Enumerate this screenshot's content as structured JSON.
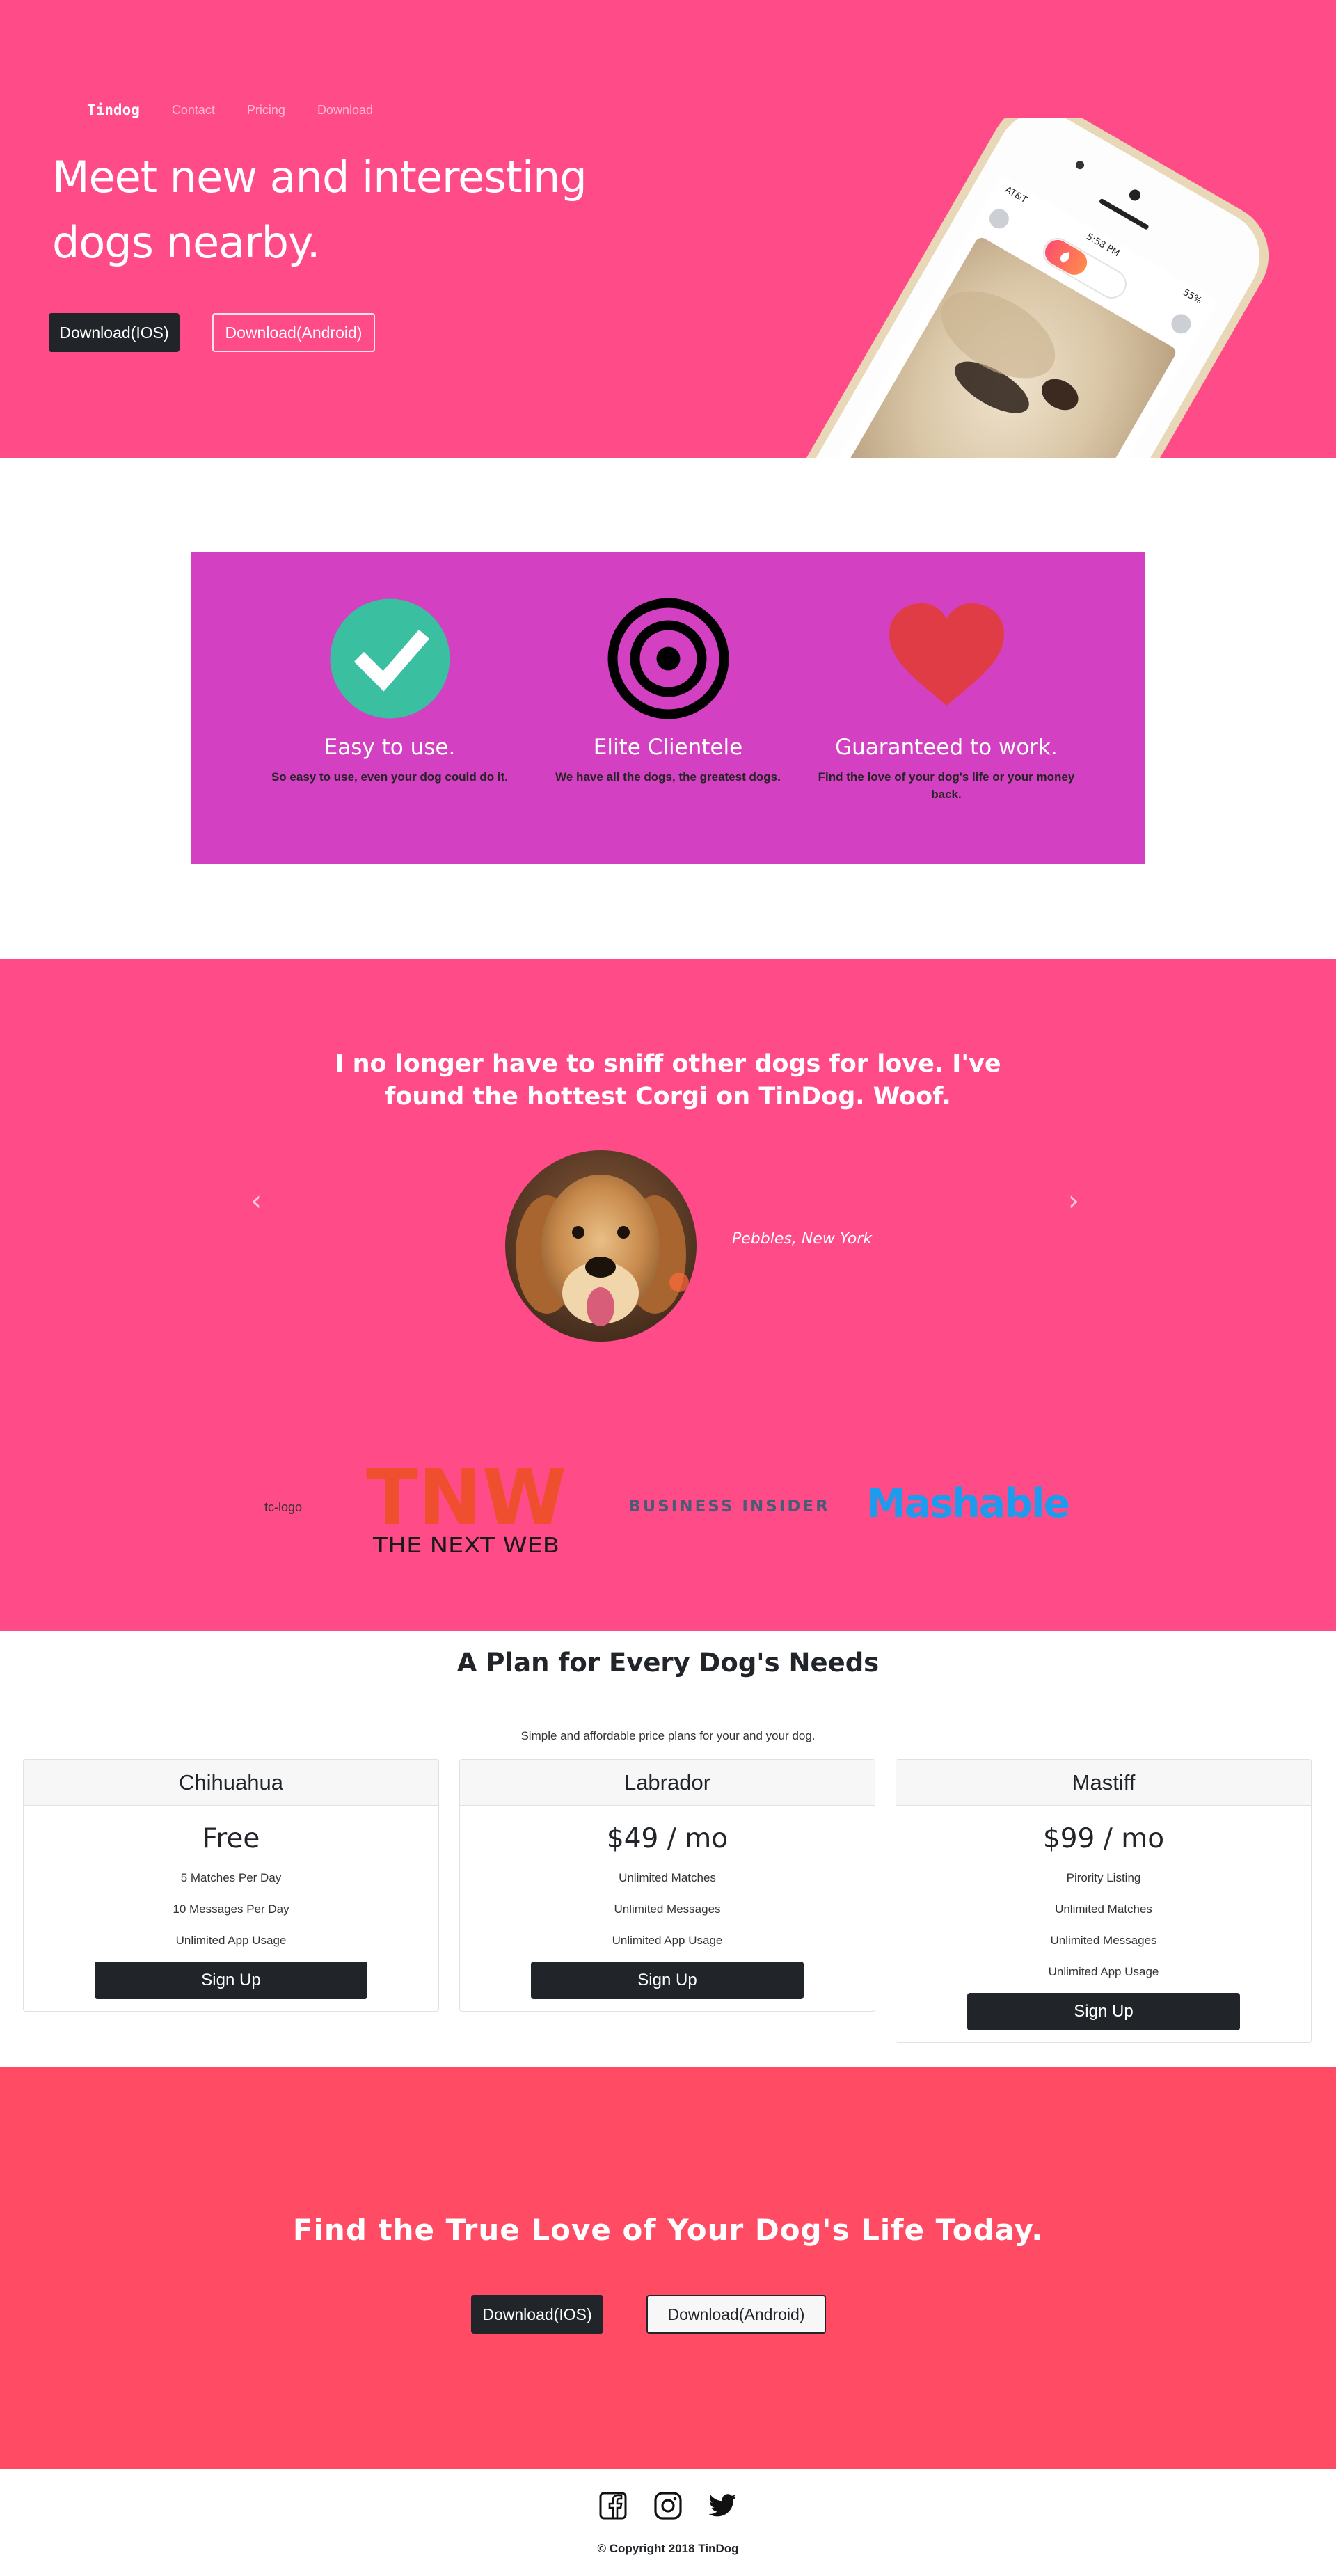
{
  "nav": {
    "brand": "Tindog",
    "links": [
      "Contact",
      "Pricing",
      "Download"
    ]
  },
  "hero": {
    "title": "Meet new and interesting dogs nearby.",
    "btn_ios": "Download(IOS)",
    "btn_android": "Download(Android)",
    "phone_status": {
      "carrier": "AT&T",
      "time": "5:58 PM",
      "battery": "55%"
    }
  },
  "features": [
    {
      "icon": "check-circle-icon",
      "title": "Easy to use.",
      "text": "So easy to use, even your dog could do it."
    },
    {
      "icon": "bullseye-icon",
      "title": "Elite Clientele",
      "text": "We have all the dogs, the greatest dogs."
    },
    {
      "icon": "heart-icon",
      "title": "Guaranteed to work.",
      "text": "Find the love of your dog's life or your money back."
    }
  ],
  "testimonial": {
    "quote": "I no longer have to sniff other dogs for love. I've found the hottest Corgi on TinDog. Woof.",
    "caption": "Pebbles, New York",
    "prev": "‹",
    "next": "›"
  },
  "press": {
    "tc_alt": "tc-logo",
    "tnw_label": "THE NEXT WEB",
    "tnw_mark": "TNW",
    "bi": "BUSINESS INSIDER",
    "mashable": "Mashable"
  },
  "pricing": {
    "title": "A Plan for Every Dog's Needs",
    "subtitle": "Simple and affordable price plans for your and your dog.",
    "plans": [
      {
        "name": "Chihuahua",
        "price": "Free",
        "features": [
          "5 Matches Per Day",
          "10 Messages Per Day",
          "Unlimited App Usage"
        ],
        "cta": "Sign Up"
      },
      {
        "name": "Labrador",
        "price": "$49 / mo",
        "features": [
          "Unlimited Matches",
          "Unlimited Messages",
          "Unlimited App Usage"
        ],
        "cta": "Sign Up"
      },
      {
        "name": "Mastiff",
        "price": "$99 / mo",
        "features": [
          "Pirority Listing",
          "Unlimited Matches",
          "Unlimited Messages",
          "Unlimited App Usage"
        ],
        "cta": "Sign Up"
      }
    ]
  },
  "cta": {
    "title": "Find the True Love of Your Dog's Life Today.",
    "btn_ios": "Download(IOS)",
    "btn_android": "Download(Android)"
  },
  "footer": {
    "icons": [
      "facebook-icon",
      "instagram-icon",
      "twitter-icon"
    ],
    "copyright": "© Copyright 2018 TinDog"
  },
  "colors": {
    "hero_bg": "#ff4c89",
    "features_bg": "#d340c1",
    "cta_bg": "#ff4b64",
    "dark": "#212529"
  }
}
